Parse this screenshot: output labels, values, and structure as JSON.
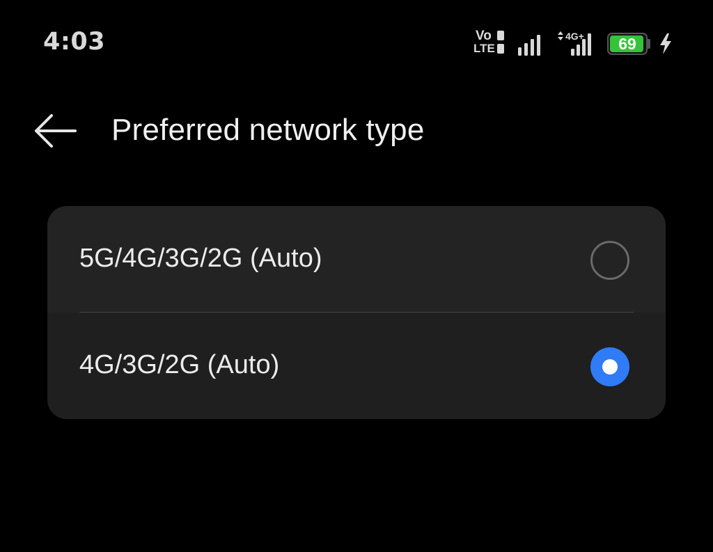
{
  "status_bar": {
    "time": "4:03",
    "volte_top": "Vo",
    "volte_bottom": "LTE",
    "network_badge": "4G+",
    "battery_percent": "69",
    "battery_level": 0.69,
    "charging": true,
    "icons": [
      "volte-icon",
      "signal-icon",
      "signal-4g-plus-icon",
      "battery-icon",
      "charging-bolt-icon"
    ]
  },
  "header": {
    "title": "Preferred network type",
    "back_icon": "arrow-left-icon"
  },
  "options": [
    {
      "label": "5G/4G/3G/2G (Auto)",
      "selected": false
    },
    {
      "label": "4G/3G/2G (Auto)",
      "selected": true
    }
  ],
  "colors": {
    "background": "#000000",
    "card": "#232323",
    "accent": "#2f7cf6",
    "battery_fill": "#34c339"
  }
}
